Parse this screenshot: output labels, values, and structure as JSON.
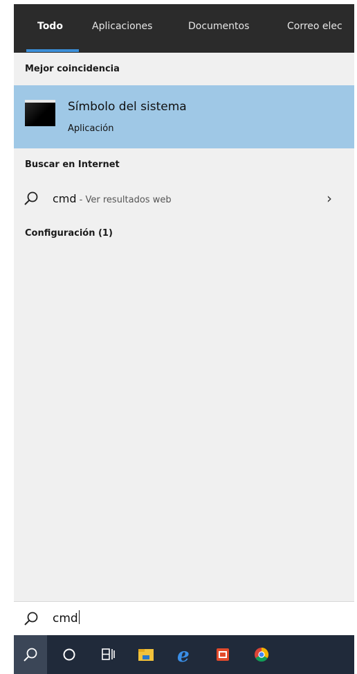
{
  "tabs": [
    {
      "label": "Todo",
      "active": true
    },
    {
      "label": "Aplicaciones",
      "active": false
    },
    {
      "label": "Documentos",
      "active": false
    },
    {
      "label": "Correo elec",
      "active": false
    }
  ],
  "sections": {
    "best_match": "Mejor coincidencia",
    "web": "Buscar en Internet",
    "settings": "Configuración (1)"
  },
  "best_match_item": {
    "title": "Símbolo del sistema",
    "subtitle": "Aplicación",
    "icon": "command-prompt-icon"
  },
  "web_result": {
    "query": "cmd",
    "suffix": " - Ver resultados web",
    "icon": "search-icon",
    "chevron": "chevron-right-icon"
  },
  "search_box": {
    "value": "cmd"
  },
  "taskbar": {
    "items": [
      "search-icon",
      "cortana-icon",
      "task-view-icon",
      "file-explorer-icon",
      "edge-icon",
      "office-icon",
      "chrome-icon"
    ]
  },
  "colors": {
    "tab_bar": "#2b2b2b",
    "accent": "#3b8fd8",
    "selected_item": "#9fc8e6",
    "panel": "#f0f0f0",
    "taskbar": "#202a3a"
  }
}
